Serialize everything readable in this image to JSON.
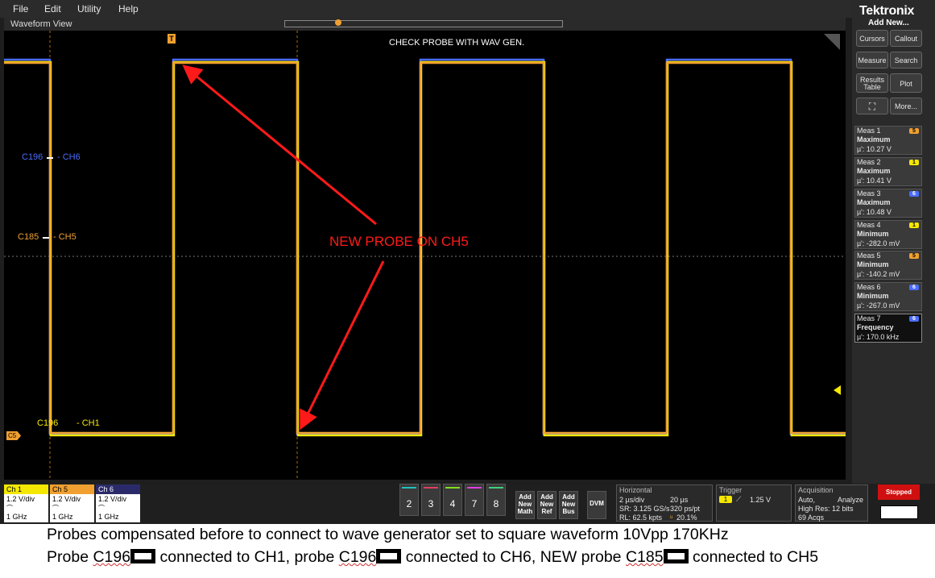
{
  "menu": [
    "File",
    "Edit",
    "Utility",
    "Help"
  ],
  "window_title": "Waveform View",
  "trigger_marker": "T",
  "annotation_top": "CHECK PROBE WITH WAV GEN.",
  "annotation_probe": "NEW PROBE ON CH5",
  "labels": {
    "c196_ch6_probe": "C196",
    "c196_ch6_channel": "- CH6",
    "c185_ch5_probe": "C185",
    "c185_ch5_channel": "- CH5",
    "c196_ch1_probe": "C196",
    "c196_ch1_channel": "- CH1",
    "c5_marker": "C5"
  },
  "brand": "Tektronix",
  "add_new": "Add New...",
  "right_buttons": [
    "Cursors",
    "Callout",
    "Measure",
    "Search",
    "Results Table",
    "Plot",
    "More..."
  ],
  "measurements": [
    {
      "name": "Meas 1",
      "badge": "5",
      "type": "Maximum",
      "value": "µ': 10.27 V",
      "color": "#f0a030"
    },
    {
      "name": "Meas 2",
      "badge": "1",
      "type": "Maximum",
      "value": "µ': 10.41 V",
      "color": "#f5e800"
    },
    {
      "name": "Meas 3",
      "badge": "6",
      "type": "Maximum",
      "value": "µ': 10.48 V",
      "color": "#4a6cff"
    },
    {
      "name": "Meas 4",
      "badge": "1",
      "type": "Minimum",
      "value": "µ': -282.0 mV",
      "color": "#f5e800"
    },
    {
      "name": "Meas 5",
      "badge": "5",
      "type": "Minimum",
      "value": "µ': -140.2 mV",
      "color": "#f0a030"
    },
    {
      "name": "Meas 6",
      "badge": "6",
      "type": "Minimum",
      "value": "µ': -267.0 mV",
      "color": "#4a6cff"
    },
    {
      "name": "Meas 7",
      "badge": "6",
      "type": "Frequency",
      "value": "µ': 170.0 kHz",
      "color": "#4a6cff"
    }
  ],
  "channels": [
    {
      "name": "Ch 1",
      "scale": "1.2 V/div",
      "bw": "1 GHz",
      "color": "#f5e800"
    },
    {
      "name": "Ch 5",
      "scale": "1.2 V/div",
      "bw": "1 GHz",
      "color": "#f0a030"
    },
    {
      "name": "Ch 6",
      "scale": "1.2 V/div",
      "bw": "1 GHz",
      "color": "#4a6cff"
    }
  ],
  "channel_buttons": [
    "2",
    "3",
    "4",
    "7",
    "8"
  ],
  "channel_button_colors": [
    "#20c0c0",
    "#e04060",
    "#80e020",
    "#e040e0",
    "#40d080"
  ],
  "add_buttons": [
    "Add New Math",
    "Add New Ref",
    "Add New Bus"
  ],
  "dvm": "DVM",
  "horizontal": {
    "title": "Horizontal",
    "scale": "2 µs/div",
    "position": "20 µs",
    "sr": "SR: 3.125 GS/s",
    "ps": "320 ps/pt",
    "rl": "RL: 62.5 kpts",
    "pct": "20.1%"
  },
  "trigger": {
    "title": "Trigger",
    "source": "1",
    "level": "1.25 V"
  },
  "acquisition": {
    "title": "Acquisition",
    "mode": "Auto,",
    "analyze": "Analyze",
    "res": "High Res: 12 bits",
    "acqs": "69 Acqs"
  },
  "status": "Stopped",
  "caption": {
    "line1": "Probes compensated before to  connect to wave generator set to square waveform 10Vpp 170KHz",
    "l2_a": "Probe",
    "l2_b": "C196",
    "l2_c": "connected to CH1, probe",
    "l2_d": "C196",
    "l2_e": "connected to CH6, NEW probe",
    "l2_f": "C185",
    "l2_g": "connected to CH5"
  },
  "colors": {
    "ch1": "#f5e800",
    "ch5": "#f0a030",
    "ch6": "#4a6cff",
    "annotation": "#ff1a1a"
  }
}
